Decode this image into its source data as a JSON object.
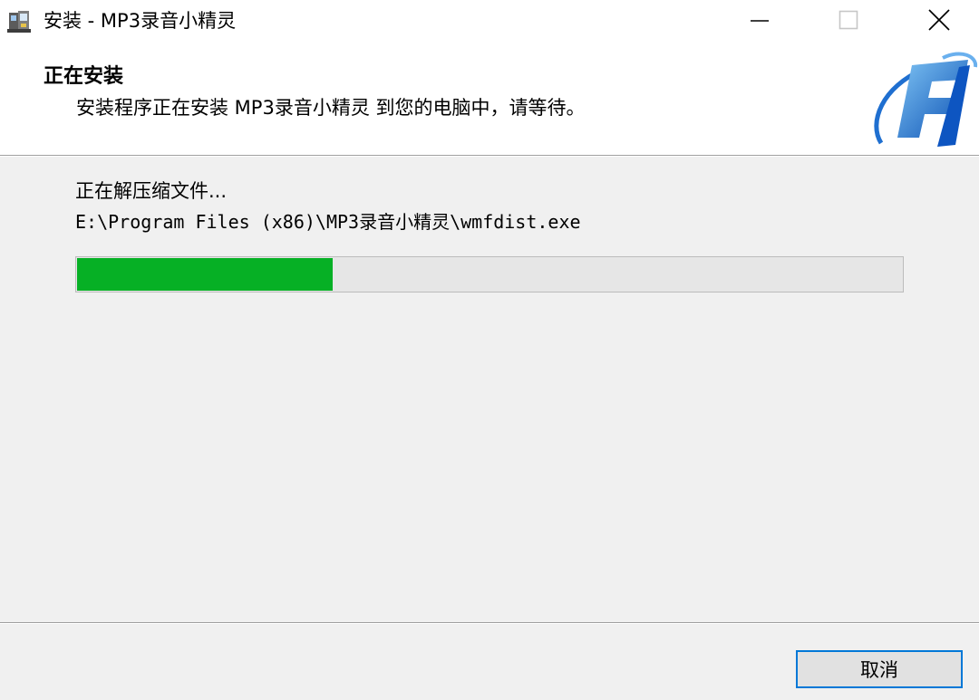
{
  "window": {
    "title": "安装 - MP3录音小精灵",
    "icon": "installer-icon",
    "controls": {
      "minimize": "minimize-icon",
      "maximize": "maximize-icon",
      "close": "close-icon"
    }
  },
  "header": {
    "title": "正在安装",
    "subtitle": "安装程序正在安装 MP3录音小精灵 到您的电脑中，请等待。",
    "logo": "brand-logo"
  },
  "progress": {
    "status": "正在解压缩文件...",
    "current_file": "E:\\Program Files (x86)\\MP3录音小精灵\\wmfdist.exe",
    "fraction": 0.31,
    "fill_color": "#06b025"
  },
  "footer": {
    "cancel_label": "取消"
  },
  "colors": {
    "accent": "#0078d7",
    "dialog_bg": "#f0f0f0"
  }
}
